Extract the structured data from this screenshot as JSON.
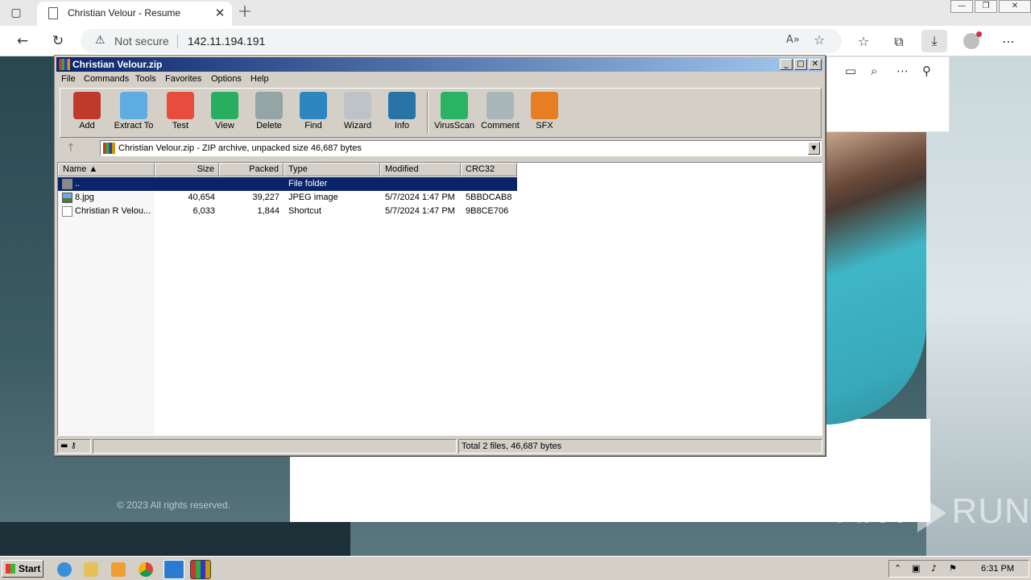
{
  "browser": {
    "tab_title": "Christian Velour - Resume",
    "security_label": "Not secure",
    "url": "142.11.194.191"
  },
  "page": {
    "copyright": "© 2023 All rights reserved.",
    "watermark": "ANY",
    "watermark2": "RUN"
  },
  "winrar": {
    "title": "Christian Velour.zip",
    "menu": [
      "File",
      "Commands",
      "Tools",
      "Favorites",
      "Options",
      "Help"
    ],
    "toolbar": [
      {
        "label": "Add",
        "color": "#c0392b"
      },
      {
        "label": "Extract To",
        "color": "#5dade2"
      },
      {
        "label": "Test",
        "color": "#e74c3c"
      },
      {
        "label": "View",
        "color": "#27ae60"
      },
      {
        "label": "Delete",
        "color": "#95a5a6"
      },
      {
        "label": "Find",
        "color": "#2e86c1"
      },
      {
        "label": "Wizard",
        "color": "#bdc3c7"
      },
      {
        "label": "Info",
        "color": "#2874a6"
      },
      {
        "label": "VirusScan",
        "color": "#28b463"
      },
      {
        "label": "Comment",
        "color": "#aab7b8"
      },
      {
        "label": "SFX",
        "color": "#e67e22"
      }
    ],
    "path_text": "Christian Velour.zip - ZIP archive, unpacked size 46,687 bytes",
    "columns": [
      "Name",
      "Size",
      "Packed",
      "Type",
      "Modified",
      "CRC32"
    ],
    "rows": [
      {
        "name": "..",
        "size": "",
        "packed": "",
        "type": "File folder",
        "modified": "",
        "crc": "",
        "icon": "folder-icon"
      },
      {
        "name": "8.jpg",
        "size": "40,654",
        "packed": "39,227",
        "type": "JPEG image",
        "modified": "5/7/2024 1:47 PM",
        "crc": "5BBDCAB8",
        "icon": "image-file-icon"
      },
      {
        "name": "Christian R Velou...",
        "size": "6,033",
        "packed": "1,844",
        "type": "Shortcut",
        "modified": "5/7/2024 1:47 PM",
        "crc": "9B8CE706",
        "icon": "shortcut-file-icon"
      }
    ],
    "status_total": "Total 2 files, 46,687 bytes"
  },
  "taskbar": {
    "start_label": "Start",
    "clock": "6:31 PM"
  }
}
